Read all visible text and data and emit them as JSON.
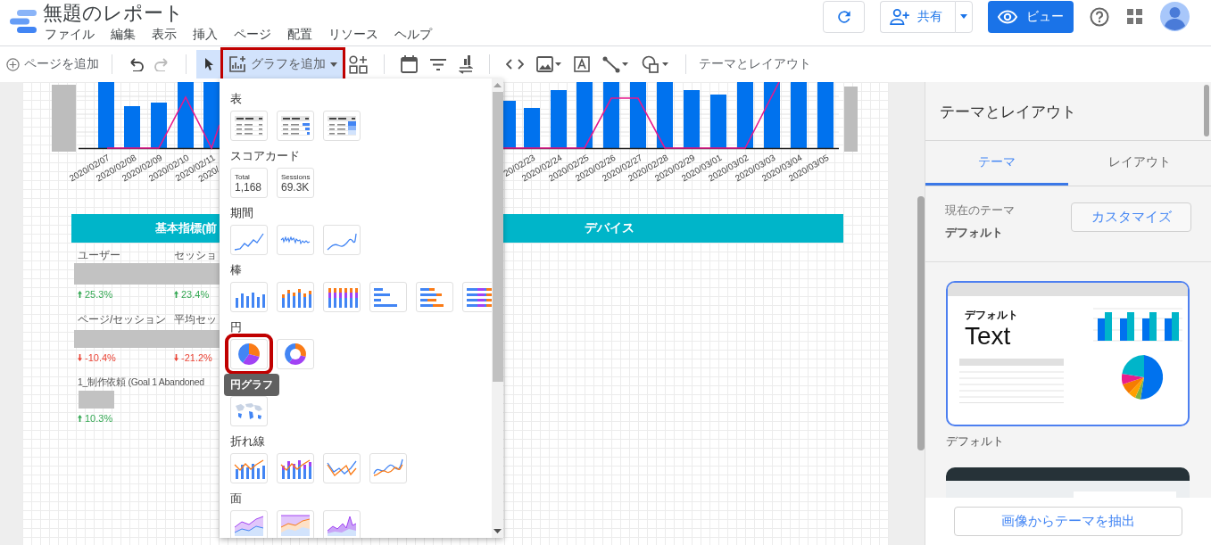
{
  "header": {
    "title": "無題のレポート",
    "menus": [
      "ファイル",
      "編集",
      "表示",
      "挿入",
      "ページ",
      "配置",
      "リソース",
      "ヘルプ"
    ],
    "share_label": "共有",
    "view_label": "ビュー"
  },
  "toolbar": {
    "add_page": "ページを追加",
    "history": [
      {
        "kind": "undo",
        "disabled": false
      },
      {
        "kind": "redo",
        "disabled": true
      }
    ],
    "select_selected": true,
    "add_chart": {
      "label": "グラフを追加",
      "selected": true,
      "annotated": true
    },
    "theme_layout": "テーマとレイアウト"
  },
  "canvas": {
    "chart_left_labels": [
      "2020/02/07",
      "2020/02/08",
      "2020/02/09",
      "2020/02/10",
      "2020/02/11",
      "2020/"
    ],
    "chart_right_labels": [
      "20/02/23",
      "2020/02/24",
      "2020/02/25",
      "2020/02/26",
      "2020/02/27",
      "2020/02/28",
      "2020/02/29",
      "2020/03/01",
      "2020/03/02",
      "2020/03/03",
      "2020/03/04",
      "2020/03/05"
    ],
    "headers": [
      "基本指標(前",
      "デバイス"
    ],
    "metric_rows": [
      {
        "kind": "pair",
        "metrics": [
          {
            "label": "ユーザー",
            "change": "25.3%",
            "kind": "up"
          },
          {
            "label": "セッショ",
            "change": "23.4%",
            "kind": "up"
          }
        ]
      },
      {
        "kind": "pair",
        "metrics": [
          {
            "label": "ページ/セッション",
            "change": "-10.4%",
            "kind": "down"
          },
          {
            "label": "平均セッ",
            "change": "-21.2%",
            "kind": "down"
          }
        ]
      },
      {
        "kind": "single",
        "metrics": [
          {
            "label": "1_制作依頼 (Goal 1 Abandoned",
            "change": "10.3%",
            "kind": "up"
          }
        ]
      }
    ]
  },
  "chart_menu": {
    "sections": [
      {
        "heading": "表",
        "items": [
          {
            "kind": "table"
          },
          {
            "kind": "table-bars"
          },
          {
            "kind": "table-heatmap"
          }
        ]
      },
      {
        "heading": "スコアカード",
        "items": [
          {
            "kind": "scorecard",
            "caption": "Total",
            "value": "1,168"
          },
          {
            "kind": "scorecard",
            "caption": "Sessions",
            "value": "69.3K"
          }
        ]
      },
      {
        "heading": "期間",
        "items": [
          {
            "kind": "time-line"
          },
          {
            "kind": "time-sparkline"
          },
          {
            "kind": "time-smooth"
          }
        ]
      },
      {
        "heading": "棒",
        "items": [
          {
            "kind": "column"
          },
          {
            "kind": "column-stacked"
          },
          {
            "kind": "column-full"
          },
          {
            "kind": "bar"
          },
          {
            "kind": "bar-stacked"
          },
          {
            "kind": "bar-full"
          }
        ]
      },
      {
        "heading": "円",
        "items": [
          {
            "kind": "pie",
            "annotated": true
          },
          {
            "kind": "donut",
            "annotated": false
          }
        ]
      },
      {
        "items": [
          {
            "kind": "geo"
          }
        ]
      },
      {
        "heading": "折れ線",
        "items": [
          {
            "kind": "combo"
          },
          {
            "kind": "combo-stacked"
          },
          {
            "kind": "line"
          },
          {
            "kind": "line-smooth"
          }
        ]
      },
      {
        "heading": "面",
        "items": [
          {
            "kind": "area"
          },
          {
            "kind": "area-stacked"
          },
          {
            "kind": "area-full"
          }
        ]
      }
    ],
    "tooltip": "円グラフ"
  },
  "panel": {
    "title": "テーマとレイアウト",
    "tabs": [
      {
        "label": "テーマ",
        "selected": true
      },
      {
        "label": "レイアウト",
        "selected": false
      }
    ],
    "current_label": "現在のテーマ",
    "current_value": "デフォルト",
    "customize": "カスタマイズ",
    "themes": [
      {
        "kind": "light",
        "name": "デフォルト",
        "sample_heading": "デフォルト",
        "sample_text": "Text",
        "selected": true
      },
      {
        "kind": "dark",
        "selected": false
      }
    ],
    "extract": "画像からテーマを抽出"
  }
}
